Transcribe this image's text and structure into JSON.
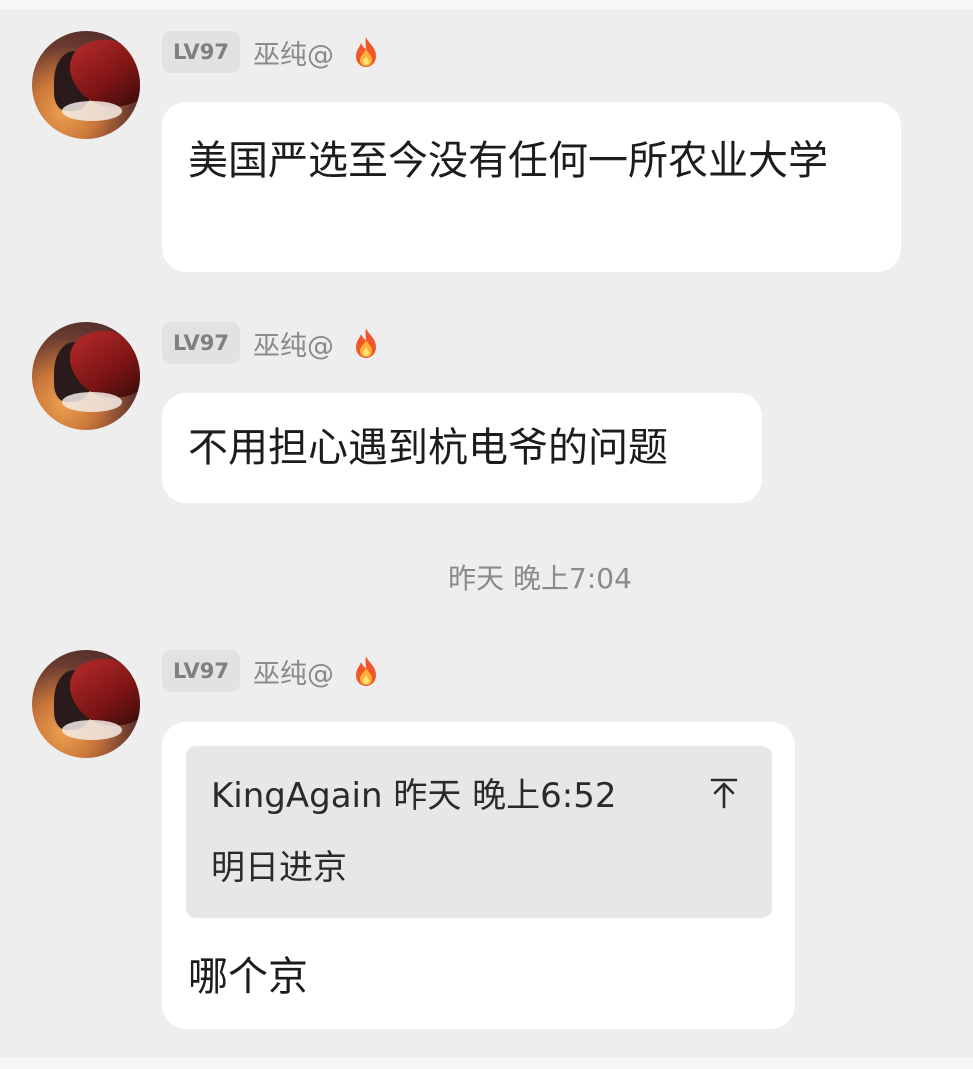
{
  "messages": [
    {
      "level": "LV97",
      "username": "巫纯@",
      "text": "美国严选至今没有任何一所农业大学"
    },
    {
      "level": "LV97",
      "username": "巫纯@",
      "text": "不用担心遇到杭电爷的问题"
    },
    {
      "level": "LV97",
      "username": "巫纯@",
      "quote": {
        "author": "KingAgain",
        "time": "昨天 晚上6:52",
        "text": "明日进京"
      },
      "text": "哪个京"
    }
  ],
  "timestamp": "昨天 晚上7:04",
  "icons": {
    "badge": "fire-icon",
    "jump": "jump-to-top-icon",
    "avatar": "anime-avatar"
  },
  "colors": {
    "background": "#efeeef",
    "bubble": "#ffffff",
    "quote_bg": "#e7e7e7",
    "meta_text": "#8a898b",
    "fire": "#f0582a"
  }
}
